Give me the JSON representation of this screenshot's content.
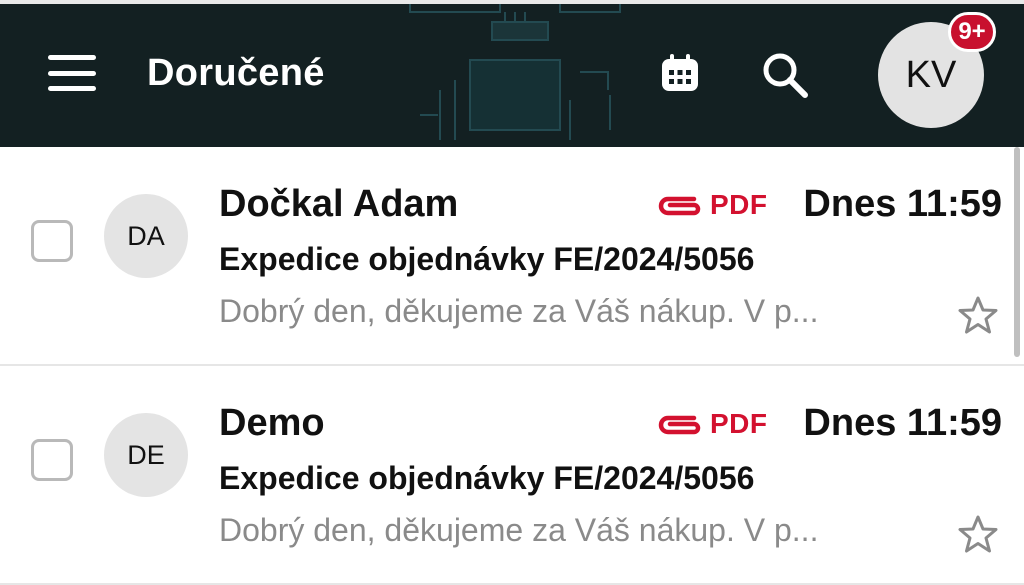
{
  "header": {
    "title": "Doručené",
    "avatar_initials": "KV",
    "notification_badge": "9+"
  },
  "icons": {
    "menu": "hamburger-icon",
    "calendar": "calendar-icon",
    "search": "search-icon",
    "attachment": "paperclip-icon",
    "star": "star-outline-icon"
  },
  "colors": {
    "header_bg": "#132022",
    "accent_red": "#d3112f",
    "badge_red": "#c8102e",
    "preview_gray": "#8a8a8a"
  },
  "messages": [
    {
      "initials": "DA",
      "sender": "Dočkal Adam",
      "attachment_label": "PDF",
      "time": "Dnes 11:59",
      "subject": "Expedice objednávky FE/2024/5056",
      "preview": "Dobrý den, děkujeme za Váš nákup. V p..."
    },
    {
      "initials": "DE",
      "sender": "Demo",
      "attachment_label": "PDF",
      "time": "Dnes 11:59",
      "subject": "Expedice objednávky FE/2024/5056",
      "preview": "Dobrý den, děkujeme za Váš nákup. V p..."
    }
  ]
}
